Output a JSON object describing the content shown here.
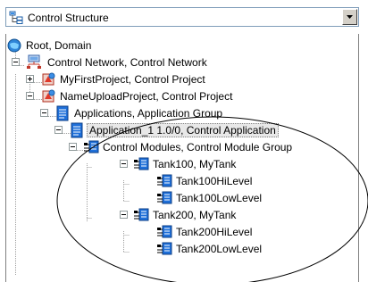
{
  "dropdown": {
    "value": "Control Structure",
    "icon": "tree-structure-icon"
  },
  "tree": {
    "nodes": [
      {
        "label": "Root, Domain",
        "icon": "globe-icon"
      },
      {
        "label": "Control Network, Control Network",
        "icon": "network-icon"
      },
      {
        "label": "MyFirstProject, Control Project",
        "icon": "project-icon"
      },
      {
        "label": "NameUploadProject, Control Project",
        "icon": "project-icon"
      },
      {
        "label": "Applications, Application Group",
        "icon": "document-icon"
      },
      {
        "label": "Application_1 1.0/0, Control Application",
        "icon": "document-icon"
      },
      {
        "label": "Control Modules, Control Module Group",
        "icon": "module-group-icon"
      },
      {
        "label": "Tank100, MyTank",
        "icon": "module-icon"
      },
      {
        "label": "Tank100HiLevel",
        "icon": "module-icon"
      },
      {
        "label": "Tank100LowLevel",
        "icon": "module-icon"
      },
      {
        "label": "Tank200, MyTank",
        "icon": "module-icon"
      },
      {
        "label": "Tank200HiLevel",
        "icon": "module-icon"
      },
      {
        "label": "Tank200LowLevel",
        "icon": "module-icon"
      }
    ]
  }
}
